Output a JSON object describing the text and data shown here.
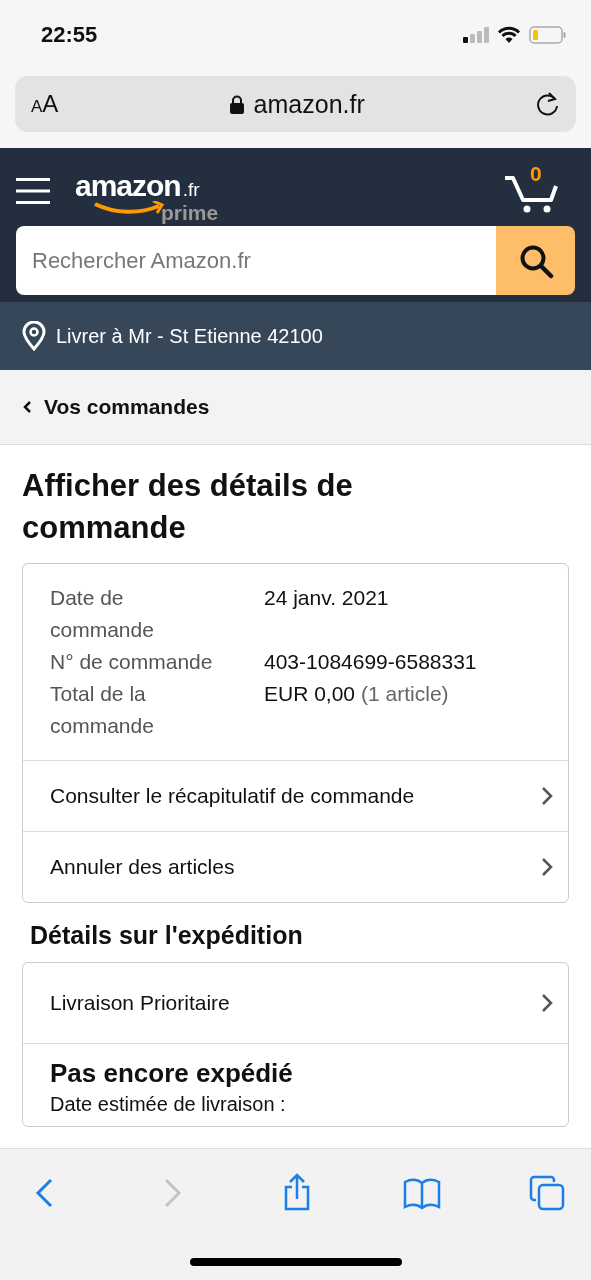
{
  "status_bar": {
    "time": "22:55"
  },
  "url_bar": {
    "text_size": "AA",
    "address": "amazon.fr"
  },
  "header": {
    "logo": "amazon",
    "logo_suffix": ".fr",
    "logo_tag": "prime",
    "cart_count": "0",
    "search": {
      "placeholder": "Rechercher Amazon.fr"
    }
  },
  "delivery": {
    "text": "Livrer à Mr - St Etienne 42100"
  },
  "back_link": {
    "label": "Vos commandes"
  },
  "title": "Afficher des détails de commande",
  "order_info": [
    {
      "label": "Date de commande",
      "value": "24 janv. 2021"
    },
    {
      "label": "N° de commande",
      "value": "403-1084699-6588331"
    },
    {
      "label": "Total de la commande",
      "value": "EUR 0,00",
      "note": "(1 article)"
    }
  ],
  "order_links": [
    {
      "label": "Consulter le récapitulatif de commande"
    },
    {
      "label": "Annuler des articles"
    }
  ],
  "shipping": {
    "heading": "Détails sur l'expédition",
    "link": "Livraison Prioritaire",
    "status": "Pas encore expédié",
    "estimate_label": "Date estimée de livraison :"
  },
  "toolbar": [
    {
      "kind": "back",
      "disabled": false
    },
    {
      "kind": "forward",
      "disabled": true
    },
    {
      "kind": "share",
      "disabled": false
    },
    {
      "kind": "bookmarks",
      "disabled": false
    },
    {
      "kind": "tabs",
      "disabled": false
    }
  ]
}
